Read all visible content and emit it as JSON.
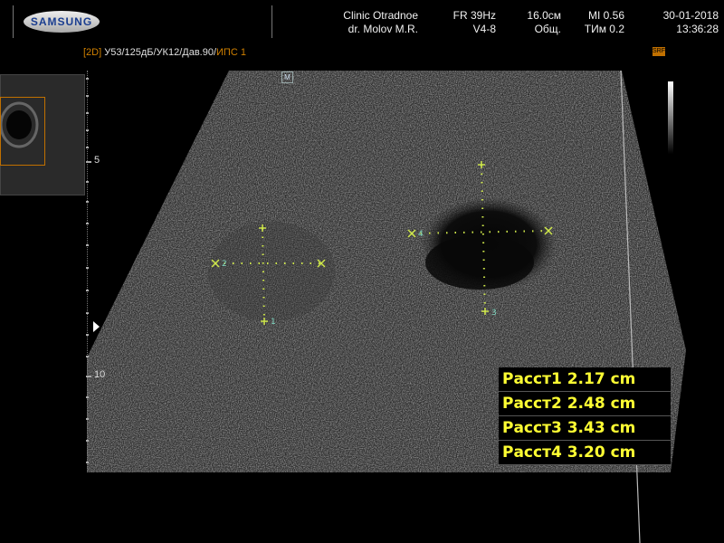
{
  "header": {
    "brand": "SAMSUNG",
    "clinic": "Clinic  Otradnoe",
    "doctor": "dr. Molov M.R.",
    "frame_rate": "FR 39Hz",
    "probe": "V4-8",
    "depth": "16.0см",
    "preset": "Общ.",
    "mi": "MI  0.56",
    "tim": "ТИм 0.2",
    "date": "30-01-2018",
    "time": "13:36:28"
  },
  "mode_line": {
    "mode": "[2D]",
    "params": " У53/125дБ/УК12/Дав.90/",
    "ips": "ИПС 1"
  },
  "icons": {
    "srf": "SRF",
    "m_marker": "M"
  },
  "scale": {
    "label_5": "5",
    "label_10": "10"
  },
  "calipers": {
    "c1": "1",
    "c2": "2",
    "c3": "3",
    "c4": "4"
  },
  "measurements": [
    {
      "label": "Расст1",
      "value": "2.17",
      "unit": "cm"
    },
    {
      "label": "Расст2",
      "value": "2.48",
      "unit": "cm"
    },
    {
      "label": "Расст3",
      "value": "3.43",
      "unit": "cm"
    },
    {
      "label": "Расст4",
      "value": "3.20",
      "unit": "cm"
    }
  ],
  "colors": {
    "caliper": "#cfe84a",
    "measurement_text": "#ffff33",
    "accent": "#c07000"
  }
}
